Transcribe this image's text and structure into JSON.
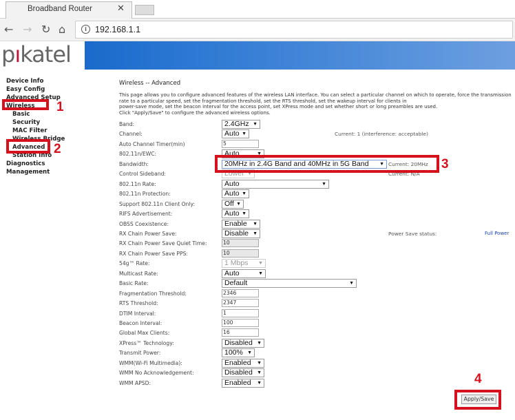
{
  "browser": {
    "tab_title": "Broadband Router",
    "url": "192.168.1.1"
  },
  "brand": {
    "logo_text": "pikatel",
    "accent": "#c0143c"
  },
  "sidebar": {
    "items": [
      {
        "label": "Device Info",
        "sub": false
      },
      {
        "label": "Easy Config",
        "sub": false
      },
      {
        "label": "Advanced Setup",
        "sub": false
      },
      {
        "label": "Wireless",
        "sub": false
      },
      {
        "label": "Basic",
        "sub": true
      },
      {
        "label": "Security",
        "sub": true
      },
      {
        "label": "MAC Filter",
        "sub": true
      },
      {
        "label": "Wireless Bridge",
        "sub": true
      },
      {
        "label": "Advanced",
        "sub": true
      },
      {
        "label": "Station Info",
        "sub": true
      },
      {
        "label": "Diagnostics",
        "sub": false
      },
      {
        "label": "Management",
        "sub": false
      }
    ]
  },
  "page": {
    "title": "Wireless -- Advanced",
    "desc_lines": [
      "This page allows you to configure advanced features of the wireless LAN interface. You can select a particular channel on which to operate, force the transmission rate to a particular speed, set the fragmentation threshold, set the RTS threshold, set the wakeup interval for clients in",
      "power-save mode, set the beacon interval for the access point, set XPress mode and set whether short or long preambles are used.",
      "Click \"Apply/Save\" to configure the advanced wireless options."
    ]
  },
  "fields": [
    {
      "label": "Band:",
      "type": "select",
      "value": "2.4GHz",
      "disabled": false
    },
    {
      "label": "Channel:",
      "type": "select",
      "value": "Auto",
      "disabled": false,
      "note": "Current: 1 (interference: acceptable)"
    },
    {
      "label": "Auto Channel Timer(min)",
      "type": "input",
      "value": "5",
      "disabled": false
    },
    {
      "label": "802.11n/EWC:",
      "type": "select",
      "value": "Auto",
      "disabled": false
    },
    {
      "label": "Bandwidth:",
      "type": "select",
      "value": "20MHz in 2.4G Band and 40MHz in 5G Band",
      "disabled": false,
      "note": "Current: 20MHz"
    },
    {
      "label": "Control Sideband:",
      "type": "select",
      "value": "Lower",
      "disabled": true,
      "note": "Current: N/A"
    },
    {
      "label": "802.11n Rate:",
      "type": "select",
      "value": "Auto",
      "disabled": false
    },
    {
      "label": "802.11n Protection:",
      "type": "select",
      "value": "Auto",
      "disabled": false
    },
    {
      "label": "Support 802.11n Client Only:",
      "type": "select",
      "value": "Off",
      "disabled": false
    },
    {
      "label": "RIFS Advertisement:",
      "type": "select",
      "value": "Auto",
      "disabled": false
    },
    {
      "label": "OBSS Coexistence:",
      "type": "select",
      "value": "Enable",
      "disabled": false
    },
    {
      "label": "RX Chain Power Save:",
      "type": "select",
      "value": "Disable",
      "disabled": false,
      "note": "Power Save status:",
      "link": "Full Power"
    },
    {
      "label": "RX Chain Power Save Quiet Time:",
      "type": "input",
      "value": "10",
      "disabled": true
    },
    {
      "label": "RX Chain Power Save PPS:",
      "type": "input",
      "value": "10",
      "disabled": true
    },
    {
      "label": "54g™ Rate:",
      "type": "select",
      "value": "1 Mbps",
      "disabled": true
    },
    {
      "label": "Multicast Rate:",
      "type": "select",
      "value": "Auto",
      "disabled": false
    },
    {
      "label": "Basic Rate:",
      "type": "select",
      "value": "Default",
      "disabled": false
    },
    {
      "label": "Fragmentation Threshold:",
      "type": "input",
      "value": "2346",
      "disabled": false
    },
    {
      "label": "RTS Threshold:",
      "type": "input",
      "value": "2347",
      "disabled": false
    },
    {
      "label": "DTIM Interval:",
      "type": "input",
      "value": "1",
      "disabled": false
    },
    {
      "label": "Beacon Interval:",
      "type": "input",
      "value": "100",
      "disabled": false
    },
    {
      "label": "Global Max Clients:",
      "type": "input",
      "value": "16",
      "disabled": false
    },
    {
      "label": "XPress™ Technology:",
      "type": "select",
      "value": "Disabled",
      "disabled": false
    },
    {
      "label": "Transmit Power:",
      "type": "select",
      "value": "100%",
      "disabled": false
    },
    {
      "label": "WMM(Wi-Fi Multimedia):",
      "type": "select",
      "value": "Enabled",
      "disabled": false
    },
    {
      "label": "WMM No Acknowledgement:",
      "type": "select",
      "value": "Disabled",
      "disabled": false
    },
    {
      "label": "WMM APSD:",
      "type": "select",
      "value": "Enabled",
      "disabled": false
    }
  ],
  "apply_label": "Apply/Save",
  "annotations": {
    "n1": "1",
    "n2": "2",
    "n3": "3",
    "n4": "4",
    "color": "#d6111e"
  }
}
